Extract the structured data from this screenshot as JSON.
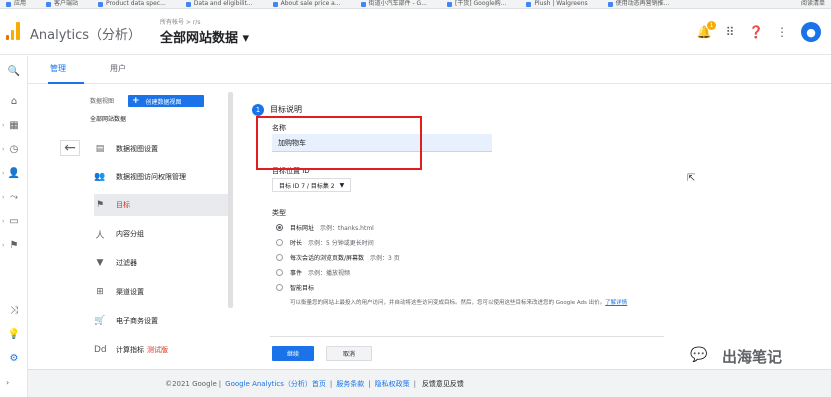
{
  "bookmarks": {
    "items": [
      "应用",
      "客户端站",
      "Product data spec...",
      "Data and eligibilit...",
      "About sale price a...",
      "街道小汽车部件 - G...",
      "[干货] Google购...",
      "Plush | Walgreens",
      "使用动态再营销推..."
    ],
    "right": "阅读清单"
  },
  "header": {
    "app_title": "Analytics（分析）",
    "account_path": "所有帐号 > r/s",
    "view_name": "全部网站数据",
    "notification_count": "1"
  },
  "tabs": [
    "管理",
    "用户"
  ],
  "left_column": {
    "data_view_label": "数据视图",
    "create_button": "创建数据视图",
    "view_name": "全部网站数据"
  },
  "menu": [
    {
      "label": "数据视图设置",
      "icon": "document-icon"
    },
    {
      "label": "数据视图访问权限管理",
      "icon": "people-icon"
    },
    {
      "label": "目标",
      "icon": "flag-icon",
      "active": true
    },
    {
      "label": "内容分组",
      "icon": "person-icon"
    },
    {
      "label": "过滤器",
      "icon": "filter-icon"
    },
    {
      "label": "渠道设置",
      "icon": "channel-icon"
    },
    {
      "label": "电子商务设置",
      "icon": "cart-icon"
    },
    {
      "label": "计算指标",
      "icon": "dd-icon",
      "tag": "测试版"
    }
  ],
  "form": {
    "step_number": "1",
    "step_title": "目标说明",
    "name_label": "名称",
    "name_value": "加购物车",
    "slot_label": "目标位置 ID",
    "slot_value": "目标 ID 7 / 目标集 2",
    "type_label": "类型",
    "types": [
      {
        "label": "目标网址",
        "example": "示例：thanks.html",
        "selected": true
      },
      {
        "label": "时长",
        "example": "示例：5 分钟或更长时间"
      },
      {
        "label": "每次会话的浏览页数/屏幕数",
        "example": "示例：3 页"
      },
      {
        "label": "事件",
        "example": "示例：播放视频"
      },
      {
        "label": "智能目标",
        "example": ""
      }
    ],
    "smart_desc": "可以衡量您的网站上最投入的用户访问，并自动将这些访问变成目标。然后，您可以使用这些目标来改进您的 Google Ads 出价。",
    "learn_more": "了解详情",
    "continue_button": "继续",
    "cancel_button": "取消"
  },
  "footer": {
    "copyright": "©2021 Google",
    "links": [
      "Google Analytics（分析）首页",
      "服务条款",
      "隐私权政策"
    ],
    "feedback": "反馈意见反馈"
  },
  "watermark": {
    "text": "出海笔记"
  },
  "colors": {
    "accent": "#1a73e8",
    "highlight_box": "#e01e1e",
    "logo": "#f9ab00"
  }
}
